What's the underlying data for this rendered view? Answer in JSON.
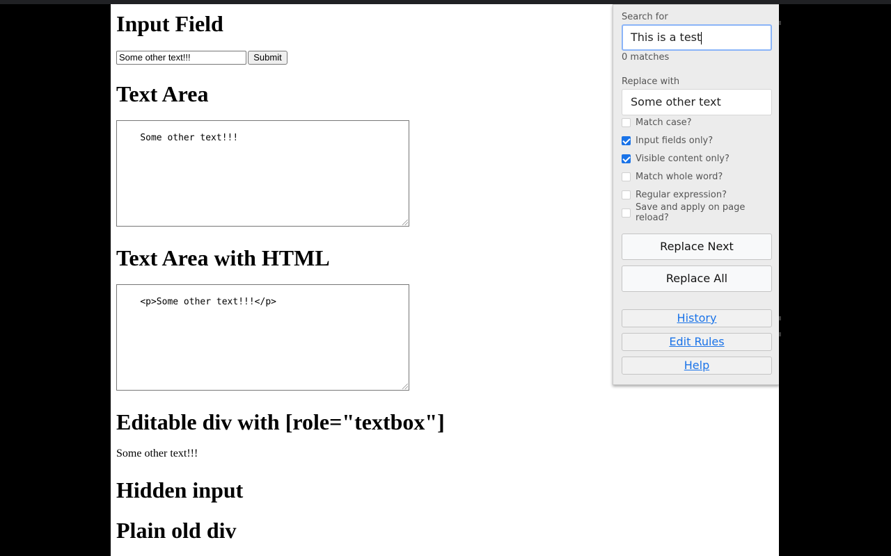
{
  "page": {
    "headings": {
      "input_field": "Input Field",
      "text_area": "Text Area",
      "text_area_html": "Text Area with HTML",
      "editable_div": "Editable div with [role=\"textbox\"]",
      "hidden_input": "Hidden input",
      "plain_div": "Plain old div"
    },
    "input_value": "Some other text!!!",
    "submit_label": "Submit",
    "textarea_value": "Some other text!!!",
    "textarea_html_value": "<p>Some other text!!!</p>",
    "editable_div_text": "Some other text!!!"
  },
  "popup": {
    "search_label": "Search for",
    "search_value": "This is a test",
    "matches_text": "0 matches",
    "replace_label": "Replace with",
    "replace_value": "Some other text",
    "options": [
      {
        "label": "Match case?",
        "checked": false
      },
      {
        "label": "Input fields only?",
        "checked": true
      },
      {
        "label": "Visible content only?",
        "checked": true
      },
      {
        "label": "Match whole word?",
        "checked": false
      },
      {
        "label": "Regular expression?",
        "checked": false
      },
      {
        "label": "Save and apply on page reload?",
        "checked": false
      }
    ],
    "replace_next_label": "Replace Next",
    "replace_all_label": "Replace All",
    "history_label": "History",
    "edit_rules_label": "Edit Rules",
    "help_label": "Help"
  },
  "colors": {
    "accent": "#1a73e8",
    "focus_ring": "#8ab4f8",
    "panel_bg": "#ececec"
  }
}
